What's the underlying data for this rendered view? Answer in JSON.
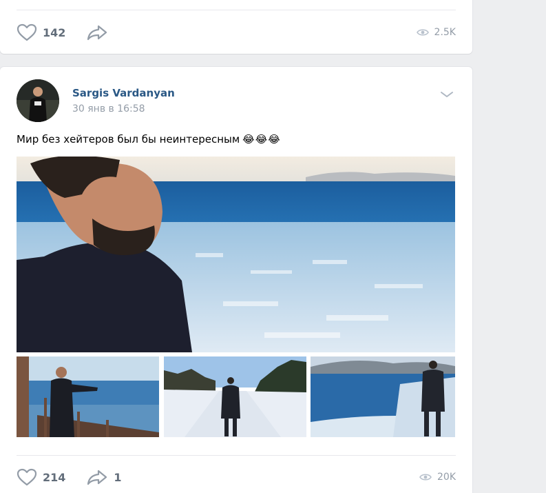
{
  "prev_post": {
    "likes": "142",
    "views": "2.5K"
  },
  "post": {
    "author": "Sargis Vardanyan",
    "date": "30 янв в 16:58",
    "text": "Мир без хейтеров был бы неинтересным",
    "emojis": [
      "😂",
      "😂",
      "😂"
    ],
    "likes": "214",
    "shares": "1",
    "views": "20K"
  },
  "icons": {
    "like": "heart-icon",
    "share": "share-arrow-icon",
    "views": "eye-icon",
    "menu": "chevron-down-icon"
  },
  "colors": {
    "link": "#2a5885",
    "muted": "#939ca7",
    "count": "#626d7a",
    "background": "#edeef0"
  }
}
